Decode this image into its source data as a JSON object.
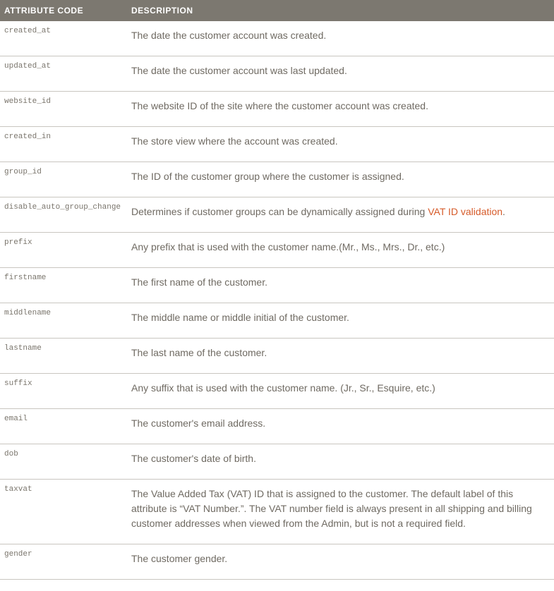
{
  "table": {
    "headers": {
      "code": "ATTRIBUTE CODE",
      "description": "DESCRIPTION"
    },
    "rows": [
      {
        "code": "created_at",
        "desc": "The date the customer account was created."
      },
      {
        "code": "updated_at",
        "desc": "The date the customer account was last updated."
      },
      {
        "code": "website_id",
        "desc": "The website ID of the site where the customer account was created."
      },
      {
        "code": "created_in",
        "desc": "The store view where the account was created."
      },
      {
        "code": "group_id",
        "desc": "The ID of the customer group where the customer is assigned."
      },
      {
        "code": "disable_auto_group_change",
        "desc_pre": "Determines if customer groups can be dynamically assigned during ",
        "link_text": "VAT ID validation",
        "desc_post": "."
      },
      {
        "code": "prefix",
        "desc": "Any prefix that is used with the customer name.(Mr., Ms., Mrs., Dr., etc.)"
      },
      {
        "code": "firstname",
        "desc": "The first name of the customer."
      },
      {
        "code": "middlename",
        "desc": "The middle name or middle initial of the customer."
      },
      {
        "code": "lastname",
        "desc": "The last name of the customer."
      },
      {
        "code": "suffix",
        "desc": "Any suffix that is used with the customer name. (Jr., Sr., Esquire, etc.)"
      },
      {
        "code": "email",
        "desc": "The customer's email address."
      },
      {
        "code": "dob",
        "desc": "The customer's date of birth."
      },
      {
        "code": "taxvat",
        "desc": "The Value Added Tax (VAT) ID that is assigned to the customer. The default label of this attribute is “VAT Number.”. The VAT number field is always present in all shipping and billing customer addresses when viewed from the Admin, but is not a required field."
      },
      {
        "code": "gender",
        "desc": "The customer gender."
      }
    ]
  }
}
